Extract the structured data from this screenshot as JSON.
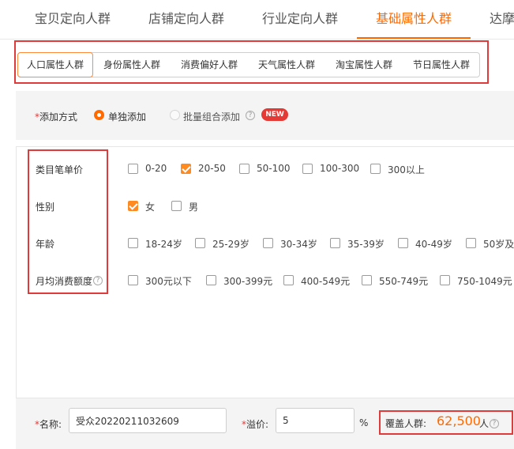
{
  "top_tabs": [
    {
      "label": "宝贝定向人群",
      "active": false
    },
    {
      "label": "店铺定向人群",
      "active": false
    },
    {
      "label": "行业定向人群",
      "active": false
    },
    {
      "label": "基础属性人群",
      "active": true
    },
    {
      "label": "达摩",
      "active": false
    }
  ],
  "sub_tabs": [
    {
      "label": "人口属性人群",
      "active": true
    },
    {
      "label": "身份属性人群",
      "active": false
    },
    {
      "label": "消费偏好人群",
      "active": false
    },
    {
      "label": "天气属性人群",
      "active": false
    },
    {
      "label": "淘宝属性人群",
      "active": false
    },
    {
      "label": "节日属性人群",
      "active": false
    }
  ],
  "add_method": {
    "required_mark": "*",
    "label": "添加方式",
    "options": [
      {
        "label": "单独添加",
        "selected": true
      },
      {
        "label": "批量组合添加",
        "selected": false
      }
    ],
    "help_icon": "?",
    "new_badge": "NEW"
  },
  "attributes": {
    "category_price": {
      "label": "类目笔单价",
      "options": [
        {
          "label": "0-20",
          "checked": false
        },
        {
          "label": "20-50",
          "checked": true
        },
        {
          "label": "50-100",
          "checked": false
        },
        {
          "label": "100-300",
          "checked": false
        },
        {
          "label": "300以上",
          "checked": false
        }
      ]
    },
    "gender": {
      "label": "性别",
      "options": [
        {
          "label": "女",
          "checked": true
        },
        {
          "label": "男",
          "checked": false
        }
      ]
    },
    "age": {
      "label": "年龄",
      "options": [
        {
          "label": "18-24岁",
          "checked": false
        },
        {
          "label": "25-29岁",
          "checked": false
        },
        {
          "label": "30-34岁",
          "checked": false
        },
        {
          "label": "35-39岁",
          "checked": false
        },
        {
          "label": "40-49岁",
          "checked": false
        },
        {
          "label": "50岁及",
          "checked": false
        }
      ]
    },
    "monthly_spend": {
      "label": "月均消费额度",
      "help_icon": "?",
      "options": [
        {
          "label": "300元以下",
          "checked": false
        },
        {
          "label": "300-399元",
          "checked": false
        },
        {
          "label": "400-549元",
          "checked": false
        },
        {
          "label": "550-749元",
          "checked": false
        },
        {
          "label": "750-1049元",
          "checked": false
        }
      ]
    }
  },
  "bottom": {
    "name_required_mark": "*",
    "name_label": "名称:",
    "name_value": "受众20220211032609",
    "premium_required_mark": "*",
    "premium_label": "溢价:",
    "premium_value": "5",
    "premium_unit": "%",
    "coverage_label": "覆盖人群:",
    "coverage_value": "62,500",
    "coverage_unit": "人",
    "coverage_help_icon": "?"
  },
  "colors": {
    "accent": "#ff6a00",
    "highlight_frame": "#e03a3a",
    "badge": "#e53935"
  }
}
